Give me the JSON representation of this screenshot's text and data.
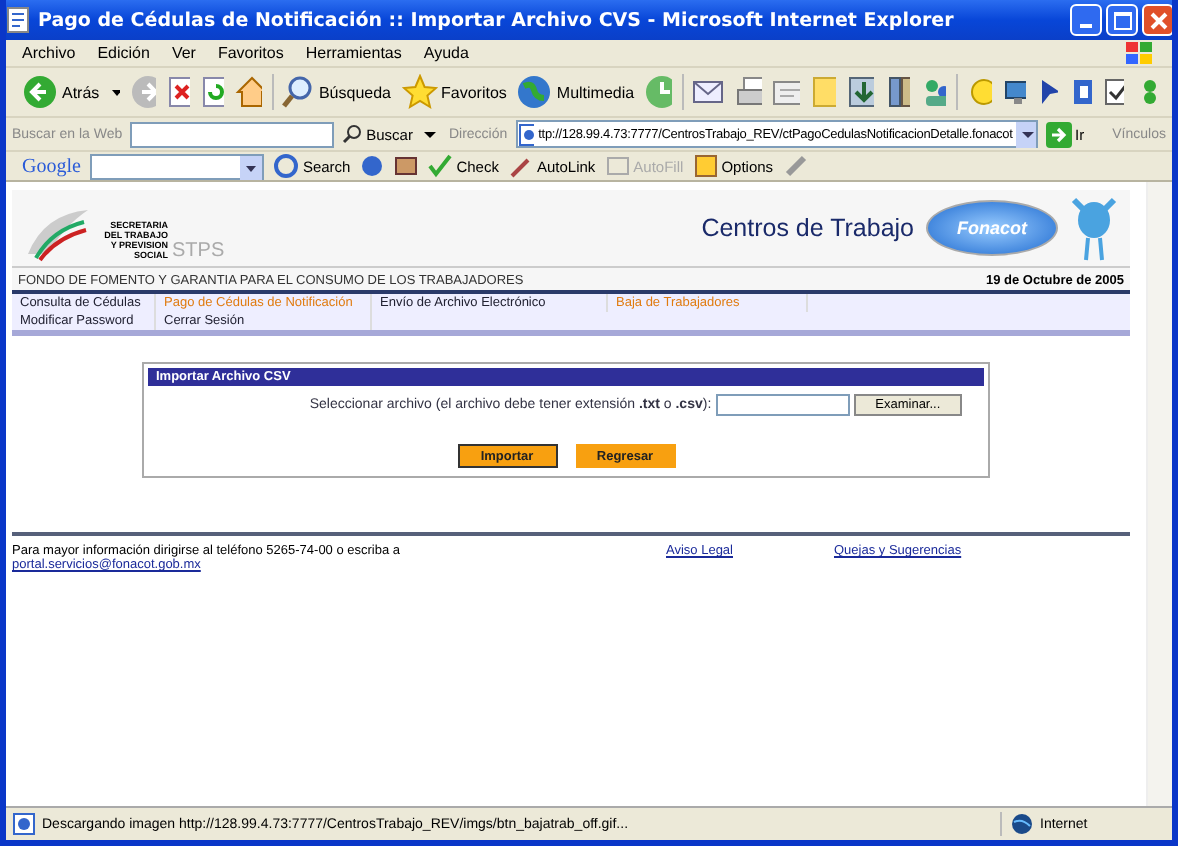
{
  "window": {
    "title": "Pago de Cédulas de Notificación :: Importar Archivo CVS - Microsoft Internet Explorer"
  },
  "menu": [
    "Archivo",
    "Edición",
    "Ver",
    "Favoritos",
    "Herramientas",
    "Ayuda"
  ],
  "toolbar": {
    "back": "Atrás",
    "search": "Búsqueda",
    "favorites": "Favoritos",
    "media": "Multimedia"
  },
  "address_bar": {
    "search_label": "Buscar en la Web",
    "search_button": "Buscar",
    "label": "Dirección",
    "url": "ttp://128.99.4.73:7777/CentrosTrabajo_REV/ctPagoCedulasNotificacionDetalle.fonacot",
    "go": "Ir",
    "links": "Vínculos"
  },
  "google_bar": {
    "logo": "Google",
    "search": "Search",
    "check": "Check",
    "autolink": "AutoLink",
    "autofill": "AutoFill",
    "options": "Options"
  },
  "page": {
    "agency": "SECRETARIA DEL TRABAJO Y PREVISION SOCIAL",
    "agency_short": "STPS",
    "heading": "Centros de Trabajo",
    "brand": "Fonacot",
    "subtitle": "FONDO DE FOMENTO Y GARANTIA PARA EL CONSUMO DE LOS TRABAJADORES",
    "date": "19 de Octubre de 2005",
    "nav": [
      {
        "label": "Consulta de Cédulas",
        "selected": false
      },
      {
        "label": "Pago de Cédulas de Notificación",
        "selected": true
      },
      {
        "label": "Envío de Archivo Electrónico",
        "selected": false
      },
      {
        "label": "Baja de Trabajadores",
        "selected": true
      },
      {
        "label": "Modificar Password",
        "selected": false
      },
      {
        "label": "Cerrar Sesión",
        "selected": false
      }
    ],
    "form": {
      "title": "Importar Archivo CSV",
      "label": "Seleccionar archivo (el archivo debe tener extensión **.txt** o **.csv**):",
      "browse": "Examinar...",
      "buttons": [
        "Importar",
        "Regresar"
      ]
    },
    "footer": {
      "text": "Para mayor información dirigirse al teléfono 5265-74-00 o escriba a",
      "email": "portal.servicios@fonacot.gob.mx",
      "links": [
        "Aviso Legal",
        "Quejas y Sugerencias"
      ]
    }
  },
  "status_bar": {
    "text": "Descargando imagen http://128.99.4.73:7777/CentrosTrabajo_REV/imgs/btn_bajatrab_off.gif...",
    "zone": "Internet"
  }
}
